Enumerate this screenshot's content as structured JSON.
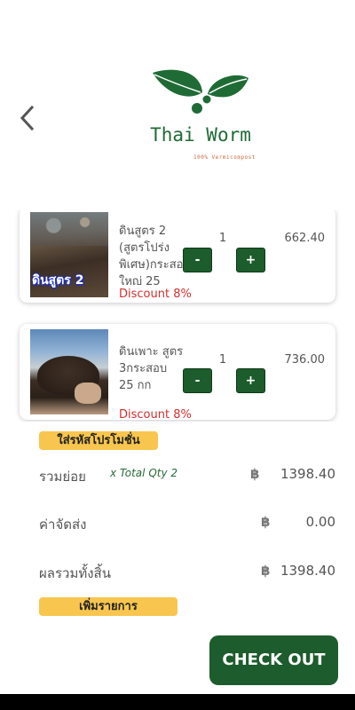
{
  "header": {
    "back_icon": "chevron-left-icon",
    "logo": {
      "name": "Thai Worm",
      "tagline": "100% Vermicompost",
      "colors": {
        "leaf": "#1f6b35",
        "berry": "#1f6b35",
        "tagline": "#c96b3f"
      }
    }
  },
  "cart": {
    "items": [
      {
        "image_label": "ดินสูตร 2",
        "name": "ดินสูตร 2 (สูตรโปร่ง พิเศษ)กระสอบใหญ่ 25",
        "discount": "Discount 8%",
        "qty": "1",
        "price": "662.40",
        "minus": "-",
        "plus": "+"
      },
      {
        "image_label": "",
        "name": "ดินเพาะ สูตร 3กระสอบ 25 กก",
        "discount": "Discount 8%",
        "qty": "1",
        "price": "736.00",
        "minus": "-",
        "plus": "+"
      }
    ]
  },
  "promo_button": "ใส่รหัสโปรโมชั่น",
  "summary": {
    "subtotal_label": "รวมย่อย",
    "total_qty": "x Total Qty 2",
    "currency": "฿",
    "subtotal_value": "1398.40",
    "shipping_label": "ค่าจัดส่ง",
    "shipping_value": "0.00",
    "grand_total_label": "ผลรวมทั้งสิ้น",
    "grand_total_value": "1398.40"
  },
  "add_items_button": "เพิ่มรายการ",
  "checkout_button": "CHECK OUT",
  "colors": {
    "primary_green": "#1d5c2c",
    "accent_yellow": "#f8c64e",
    "discount_red": "#d32f2f"
  }
}
